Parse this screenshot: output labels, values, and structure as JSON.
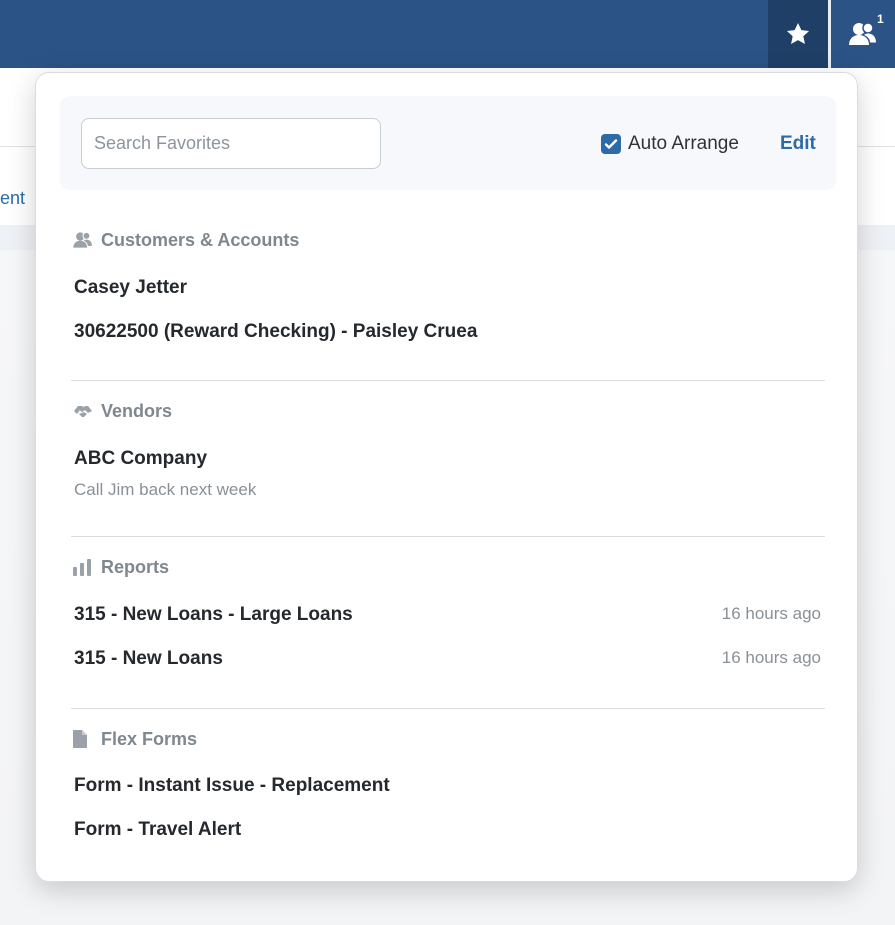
{
  "nav": {
    "favorites_icon": "star-icon",
    "users_icon": "users-icon",
    "users_badge": "1"
  },
  "background": {
    "partial_link": "ent"
  },
  "toolbar": {
    "search_placeholder": "Search Favorites",
    "search_value": "",
    "auto_arrange_label": "Auto Arrange",
    "auto_arrange_checked": true,
    "edit_label": "Edit"
  },
  "sections": [
    {
      "title": "Customers & Accounts",
      "icon": "users-icon",
      "items": [
        {
          "label": "Casey Jetter"
        },
        {
          "label": "30622500 (Reward Checking) - Paisley Cruea"
        }
      ]
    },
    {
      "title": "Vendors",
      "icon": "handshake-icon",
      "items": [
        {
          "label": "ABC Company",
          "note": "Call Jim back next week"
        }
      ]
    },
    {
      "title": "Reports",
      "icon": "bar-chart-icon",
      "items": [
        {
          "label": "315 - New Loans - Large Loans",
          "time": "16 hours ago"
        },
        {
          "label": "315 - New Loans",
          "time": "16 hours ago"
        }
      ]
    },
    {
      "title": "Flex Forms",
      "icon": "document-icon",
      "items": [
        {
          "label": "Form - Instant Issue - Replacement"
        },
        {
          "label": "Form - Travel Alert"
        }
      ]
    }
  ],
  "colors": {
    "nav_bg": "#2c5385",
    "nav_active": "#1f3f66",
    "accent": "#2c6aa8"
  }
}
